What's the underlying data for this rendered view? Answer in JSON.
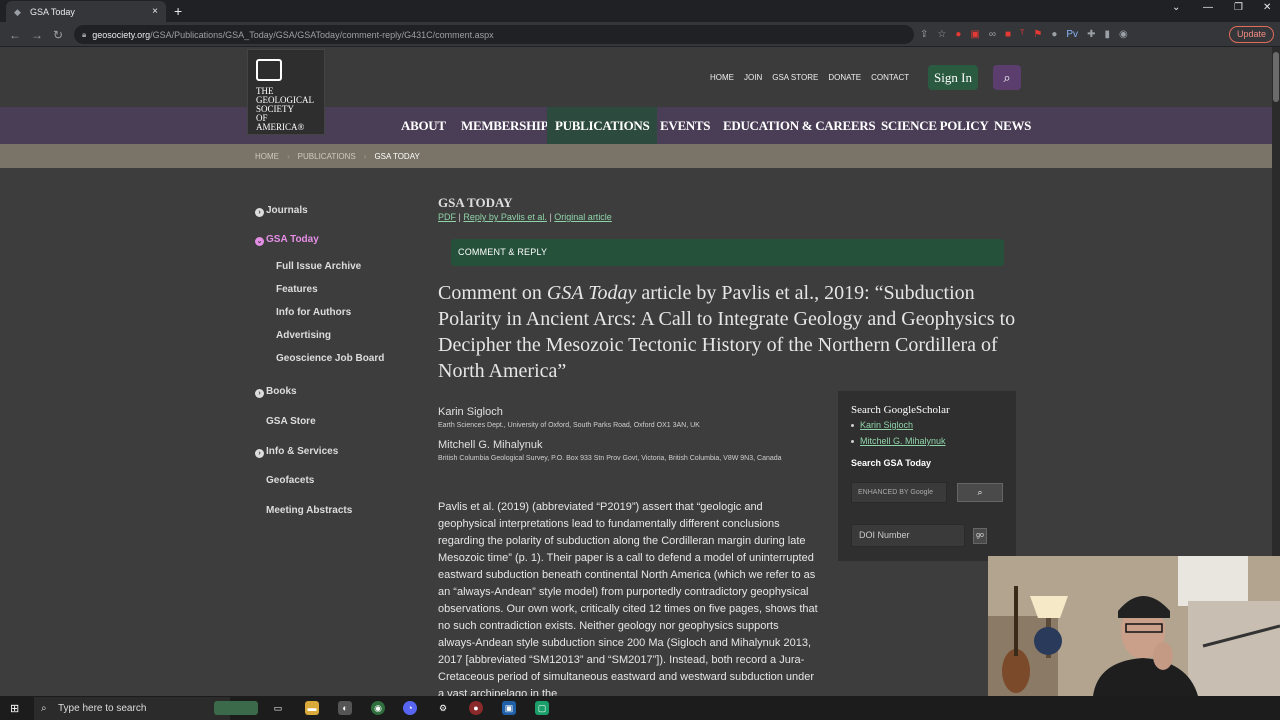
{
  "browser": {
    "tab_title": "GSA Today",
    "tab_close": "×",
    "new_tab": "+",
    "url_host": "geosociety.org",
    "url_path": "/GSA/Publications/GSA_Today/GSA/GSAToday/comment-reply/G431C/comment.aspx",
    "update_label": "Update"
  },
  "site": {
    "logo_text": [
      "THE",
      "GEOLOGICAL",
      "SOCIETY",
      "OF AMERICA®"
    ],
    "top_links": [
      "HOME",
      "JOIN",
      "GSA STORE",
      "DONATE",
      "CONTACT"
    ],
    "signin_label": "Sign In",
    "main_nav": [
      "ABOUT",
      "MEMBERSHIP",
      "PUBLICATIONS",
      "EVENTS",
      "EDUCATION & CAREERS",
      "SCIENCE POLICY",
      "NEWS"
    ],
    "breadcrumb": [
      "HOME",
      "PUBLICATIONS",
      "GSA TODAY"
    ]
  },
  "sidebar": {
    "items": [
      {
        "label": "Journals"
      },
      {
        "label": "GSA Today"
      },
      {
        "label": "Full Issue Archive"
      },
      {
        "label": "Features"
      },
      {
        "label": "Info for Authors"
      },
      {
        "label": "Advertising"
      },
      {
        "label": "Geoscience Job Board"
      },
      {
        "label": "Books"
      },
      {
        "label": "GSA Store"
      },
      {
        "label": "Info & Services"
      },
      {
        "label": "Geofacets"
      },
      {
        "label": "Meeting Abstracts"
      }
    ]
  },
  "main": {
    "section_title": "GSA TODAY",
    "sublinks": {
      "pdf": "PDF",
      "reply": "Reply by Pavlis et al.",
      "original": "Original article",
      "sep": "|"
    },
    "comment_bar": "COMMENT & REPLY",
    "title_pre": "Comment on ",
    "title_journal": "GSA Today",
    "title_post": " article by Pavlis et al., 2019: “Subduction Polarity in Ancient Arcs: A Call to Integrate Geology and Geophysics to Decipher the Mesozoic Tectonic History of the Northern Cordillera of North America”",
    "authors": [
      {
        "name": "Karin Sigloch",
        "affiliation": "Earth Sciences Dept., University of Oxford, South Parks Road, Oxford OX1 3AN, UK"
      },
      {
        "name": "Mitchell G. Mihalynuk",
        "affiliation": "British Columbia Geological Survey, P.O. Box 933 Stn Prov Govt, Victoria, British Columbia, V8W 9N3, Canada"
      }
    ],
    "body": "Pavlis et al. (2019) (abbreviated “P2019”) assert that “geologic and geophysical interpretations lead to fundamentally different conclusions regarding the polarity of subduction along the Cordilleran margin during late Mesozoic time” (p. 1). Their paper is a call to defend a model of uninterrupted eastward subduction beneath continental North America (which we refer to as an “always-Andean” style model) from purportedly contradictory geophysical observations. Our own work, critically cited 12 times on five pages, shows that no such contradiction exists. Neither geology nor geophysics supports always-Andean style subduction since 200 Ma (Sigloch and Mihalynuk 2013, 2017 [abbreviated “SM12013” and “SM2017”]). Instead, both record a Jura-Cretaceous period of simultaneous eastward and westward subduction under a vast archipelago in the"
  },
  "widget": {
    "title": "Search GoogleScholar",
    "scholar_links": [
      "Karin Sigloch",
      "Mitchell G. Mihalynuk"
    ],
    "search_label": "Search GSA Today",
    "google_placeholder": "ENHANCED BY Google",
    "doi_placeholder": "DOI Number",
    "go_label": "go"
  },
  "taskbar": {
    "search_placeholder": "Type here to search"
  }
}
